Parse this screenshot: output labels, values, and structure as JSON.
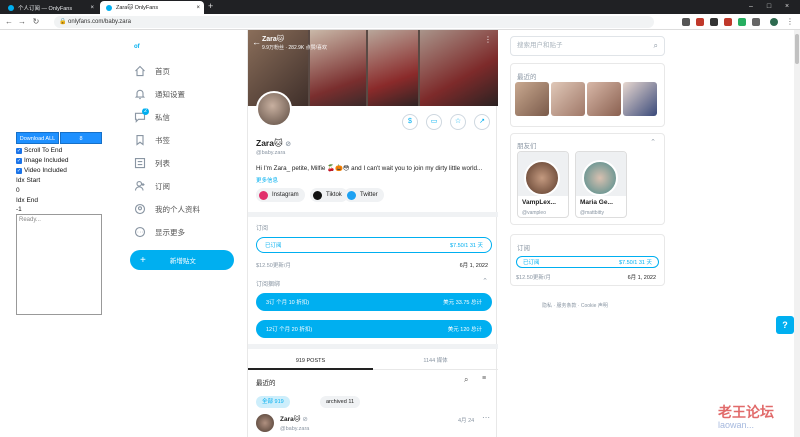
{
  "browser": {
    "tabs": [
      {
        "title": "个人订阅 — OnlyFans"
      },
      {
        "title": "Zara🐱 OnlyFans"
      }
    ],
    "url": "onlyfans.com/baby.zara"
  },
  "downloader": {
    "download_all_label": "Download ALL",
    "count_label": "8",
    "options": [
      "Scroll To End",
      "Image Included",
      "Video Included"
    ],
    "idx_start_label": "Idx Start",
    "idx_start_value": "0",
    "idx_end_label": "Idx End",
    "idx_end_value": "-1",
    "log_placeholder": "Ready..."
  },
  "nav": {
    "logo_text": "of",
    "items": [
      {
        "label": "首页",
        "icon": "home-icon"
      },
      {
        "label": "通知设置",
        "icon": "bell-icon"
      },
      {
        "label": "私信",
        "icon": "chat-icon",
        "badge": "2"
      },
      {
        "label": "书签",
        "icon": "bookmark-icon"
      },
      {
        "label": "列表",
        "icon": "list-icon"
      },
      {
        "label": "订阅",
        "icon": "subscriptions-icon"
      },
      {
        "label": "我的个人资料",
        "icon": "profile-icon"
      },
      {
        "label": "显示更多",
        "icon": "more-icon"
      }
    ],
    "new_post_label": "新增贴文"
  },
  "profile": {
    "cover_name": "Zara🐱",
    "cover_stats": "9.9万粉丝 · 282.9K 点赞/喜欢",
    "name": "Zara🐱",
    "handle": "@baby.zara",
    "bio": "Hi I'm Zara_ petite, Milfie 🍒🎃😳 and I can't wait you to join my dirty little world...",
    "more_label": "更多信息",
    "socials": [
      {
        "label": "Instagram",
        "color": "#e1306c"
      },
      {
        "label": "Tiktok",
        "color": "#111111"
      },
      {
        "label": "Twitter",
        "color": "#1da1f2"
      }
    ],
    "subscription": {
      "title": "订阅",
      "status": "已订阅",
      "price": "$7.50/1 31 天",
      "note": "$12.50更新/月",
      "date": "6月 1, 2022"
    },
    "bundles": {
      "title": "订阅捆绑",
      "items": [
        {
          "label": "3订 个月 10 折扣)",
          "price": "美元 33.75 总计"
        },
        {
          "label": "12订 个月 20 折扣)",
          "price": "美元 120 总计"
        }
      ]
    },
    "tabs": [
      "919 POSTS",
      "1144 媒体"
    ],
    "recent_label": "最近的",
    "chips": [
      "全部 919",
      "archived 11"
    ],
    "post": {
      "name": "Zara🐱",
      "handle": "@baby.zara",
      "date": "4月 24"
    }
  },
  "right": {
    "search_placeholder": "搜索用户和贴子",
    "recent_title": "最近的",
    "friends_title": "朋友们",
    "friends": [
      {
        "name": "VampLex...",
        "handle": "@vampleo"
      },
      {
        "name": "Maria Ge...",
        "handle": "@mattbitty"
      }
    ],
    "subscription": {
      "title": "订阅",
      "status": "已订阅",
      "price": "$7.50/1 31 天",
      "note": "$12.50更新/月",
      "date": "6月 1, 2022"
    },
    "footer": "隐私  ·  服务条款  ·  Cookie 声明"
  },
  "help_label": "?",
  "watermark": {
    "text": "老王论坛",
    "sub": "laowan..."
  },
  "colors": {
    "accent": "#00aff0",
    "text_muted": "#8a96a3"
  }
}
